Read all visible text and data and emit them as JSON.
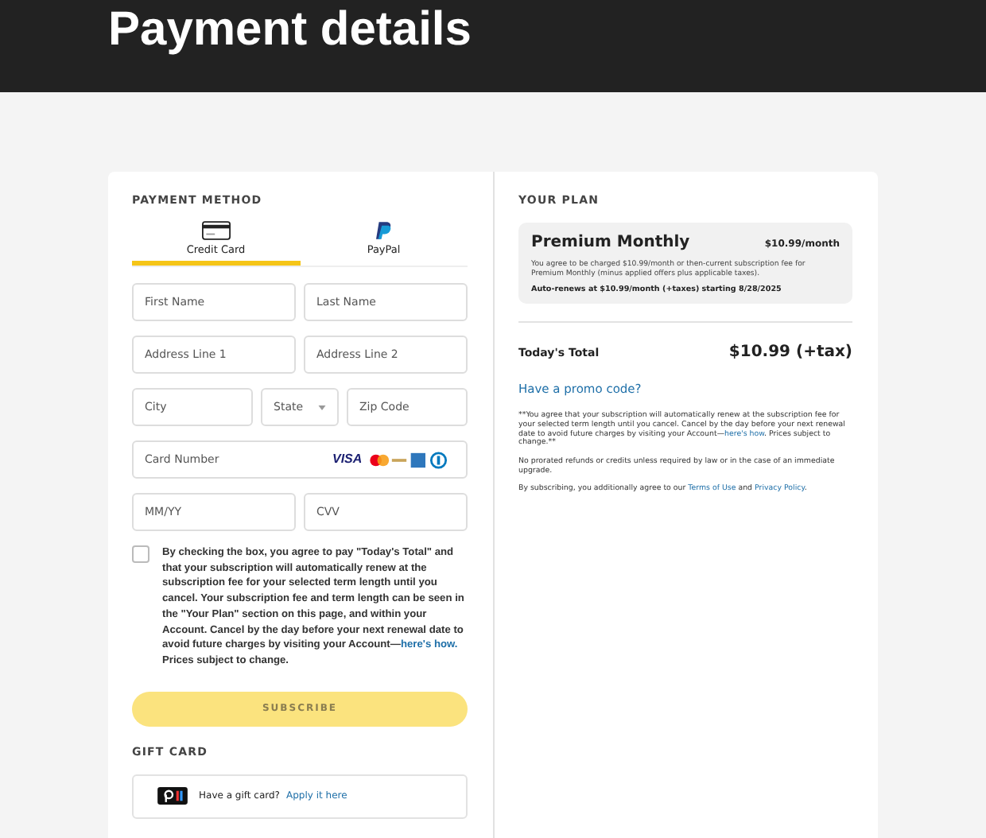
{
  "header": {
    "title": "Payment details"
  },
  "payment": {
    "heading": "PAYMENT METHOD",
    "tabs": [
      {
        "label": "Credit Card",
        "kind": "card",
        "selected": true
      },
      {
        "label": "PayPal",
        "kind": "paypal",
        "selected": false
      }
    ],
    "field_rows": [
      [
        {
          "placeholder": "First Name",
          "kind": "text"
        },
        {
          "placeholder": "Last Name",
          "kind": "text"
        }
      ],
      [
        {
          "placeholder": "Address Line 1",
          "kind": "text"
        },
        {
          "placeholder": "Address Line 2",
          "kind": "text"
        }
      ],
      [
        {
          "placeholder": "City",
          "kind": "text"
        },
        {
          "placeholder": "State",
          "kind": "select"
        },
        {
          "placeholder": "Zip Code",
          "kind": "text"
        }
      ],
      [
        {
          "placeholder": "Card Number",
          "kind": "card",
          "brand": "VISA"
        }
      ],
      [
        {
          "placeholder": "MM/YY",
          "kind": "text"
        },
        {
          "placeholder": "CVV",
          "kind": "text"
        }
      ]
    ],
    "consent": {
      "checked": false,
      "segments": [
        {
          "text": "By checking the box, you agree to pay \"Today's Total\" and that your subscription will automatically renew at the subscription fee for your selected term length until you cancel. Your subscription fee and term length can be seen in the \"Your Plan\" section on this page, and within your Account. Cancel by the day before your next renewal date to avoid future charges by visiting your Account—",
          "kind": "plain"
        },
        {
          "text": "here's how.",
          "kind": "link"
        },
        {
          "text": " Prices subject to change.",
          "kind": "plain"
        }
      ]
    },
    "subscribe": {
      "label": "SUBSCRIBE",
      "disabled": true
    },
    "gift_card": {
      "heading": "GIFT CARD",
      "text": "Have a gift card?",
      "link": "Apply it here"
    }
  },
  "plan": {
    "heading": "YOUR PLAN",
    "name": "Premium Monthly",
    "price": "$10.99/month",
    "terms": "You agree to be charged $10.99/month or then-current subscription fee for Premium Monthly (minus applied offers plus applicable taxes).",
    "renewal": "Auto-renews at $10.99/month (+taxes) starting 8/28/2025"
  },
  "total": {
    "label": "Today's Total",
    "amount": "$10.99 (+tax)"
  },
  "promo": "Have a promo code?",
  "notes": [
    [
      {
        "text": "**You agree that your subscription will automatically renew at the subscription fee for your selected term length until you cancel. Cancel by the day before your next renewal date to avoid future charges by visiting your Account—",
        "kind": "plain"
      },
      {
        "text": "here's how",
        "kind": "link"
      },
      {
        "text": ". Prices subject to change.**",
        "kind": "plain"
      }
    ],
    [
      {
        "text": "No prorated refunds or credits unless required by law or in the case of an immediate upgrade.",
        "kind": "plain"
      }
    ],
    [
      {
        "text": "By subscribing, you additionally agree to our ",
        "kind": "plain"
      },
      {
        "text": "Terms of Use",
        "kind": "link"
      },
      {
        "text": " and ",
        "kind": "plain"
      },
      {
        "text": "Privacy Policy",
        "kind": "link"
      },
      {
        "text": ".",
        "kind": "plain"
      }
    ]
  ]
}
